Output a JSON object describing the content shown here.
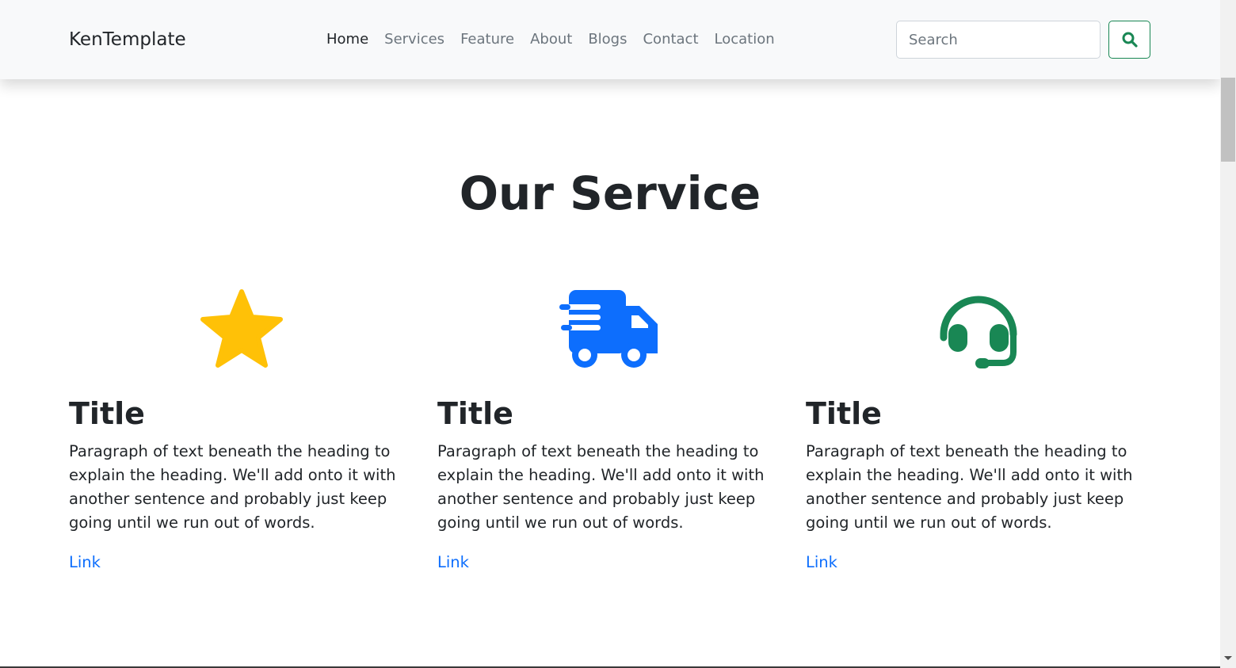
{
  "navbar": {
    "brand": "KenTemplate",
    "links": [
      "Home",
      "Services",
      "Feature",
      "About",
      "Blogs",
      "Contact",
      "Location"
    ],
    "active_link": "Home",
    "search": {
      "placeholder": "Search",
      "value": "",
      "button_icon": "search-icon"
    }
  },
  "services": {
    "title": "Our Service",
    "items": [
      {
        "icon": "star-icon",
        "icon_color": "#ffc107",
        "title": "Title",
        "text": "Paragraph of text beneath the heading to explain the heading. We'll add onto it with another sentence and probably just keep going until we run out of words.",
        "link": "Link"
      },
      {
        "icon": "truck-fast-icon",
        "icon_color": "#0d6efd",
        "title": "Title",
        "text": "Paragraph of text beneath the heading to explain the heading. We'll add onto it with another sentence and probably just keep going until we run out of words.",
        "link": "Link"
      },
      {
        "icon": "headset-icon",
        "icon_color": "#198754",
        "title": "Title",
        "text": "Paragraph of text beneath the heading to explain the heading. We'll add onto it with another sentence and probably just keep going until we run out of words.",
        "link": "Link"
      }
    ]
  },
  "colors": {
    "navbar_bg": "#f8f9fa",
    "link": "#0d6efd",
    "search_button_border": "#198754",
    "text": "#212529",
    "muted_nav": "#6c757d"
  }
}
